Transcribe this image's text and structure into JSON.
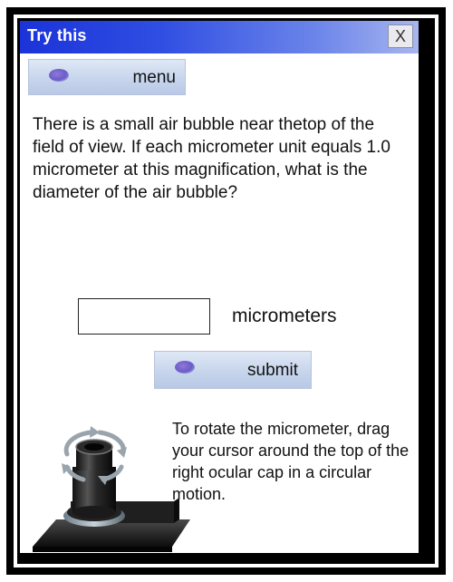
{
  "window": {
    "title": "Try this",
    "close_label": "X"
  },
  "menu_button": {
    "label": "menu"
  },
  "question": {
    "text": "There is a small air bubble near thetop of the field of view. If each micrometer unit equals 1.0 micrometer at this magnification, what is the diameter of the air bubble?"
  },
  "answer": {
    "value": "",
    "unit": "micrometers"
  },
  "submit_button": {
    "label": "submit"
  },
  "instructions": {
    "text": "To rotate the micrometer, drag your cursor around the top of the right ocular cap in a circular motion."
  },
  "icons": {
    "ocular": "ocular-eyepiece-icon",
    "rotate": "rotate-arrows-icon"
  },
  "colors": {
    "titlebar_start": "#1b33d8",
    "titlebar_end": "#a7b5ef",
    "button_fill": "#c7d5ec"
  }
}
